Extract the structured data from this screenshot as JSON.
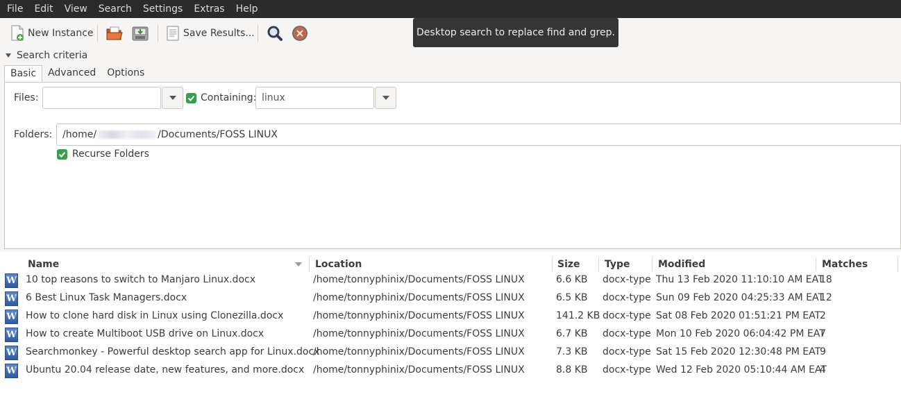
{
  "menu": [
    "File",
    "Edit",
    "View",
    "Search",
    "Settings",
    "Extras",
    "Help"
  ],
  "toolbar": {
    "new_instance": "New Instance",
    "save_results": "Save Results..."
  },
  "tooltip": "Desktop search to replace find and grep.",
  "search_criteria": {
    "expander_label": "Search criteria",
    "tabs": [
      "Basic",
      "Advanced",
      "Options"
    ],
    "files_label": "Files:",
    "files_value": "",
    "containing_label": "Containing:",
    "containing_value": "linux",
    "folders_label": "Folders:",
    "folders_value_prefix": "/home/",
    "folders_value_suffix": "/Documents/FOSS LINUX",
    "recurse_label": "Recurse Folders"
  },
  "results": {
    "columns": [
      "Name",
      "Location",
      "Size",
      "Type",
      "Modified",
      "Matches"
    ],
    "rows": [
      {
        "name": "10 top reasons to switch to Manjaro Linux.docx",
        "location": "/home/tonnyphinix/Documents/FOSS LINUX",
        "size": "6.6 KB",
        "type": "docx-type",
        "modified": "Thu 13 Feb 2020 11:10:10 AM EAT",
        "matches": "18"
      },
      {
        "name": "6 Best Linux Task Managers.docx",
        "location": "/home/tonnyphinix/Documents/FOSS LINUX",
        "size": "6.5 KB",
        "type": "docx-type",
        "modified": "Sun 09 Feb 2020 04:25:33 AM EAT",
        "matches": "12"
      },
      {
        "name": "How to clone hard disk in Linux using Clonezilla.docx",
        "location": "/home/tonnyphinix/Documents/FOSS LINUX",
        "size": "141.2 KB",
        "type": "docx-type",
        "modified": "Sat 08 Feb 2020 01:51:21 PM EAT",
        "matches": "2"
      },
      {
        "name": "How to create Multiboot USB drive on Linux.docx",
        "location": "/home/tonnyphinix/Documents/FOSS LINUX",
        "size": "6.7 KB",
        "type": "docx-type",
        "modified": "Mon 10 Feb 2020 06:04:42 PM EAT",
        "matches": "7"
      },
      {
        "name": "Searchmonkey - Powerful desktop search app for Linux.docx",
        "location": "/home/tonnyphinix/Documents/FOSS LINUX",
        "size": "7.3 KB",
        "type": "docx-type",
        "modified": "Sat 15 Feb 2020 12:30:48 PM EAT",
        "matches": "9"
      },
      {
        "name": "Ubuntu 20.04 release date, new features, and more.docx",
        "location": "/home/tonnyphinix/Documents/FOSS LINUX",
        "size": "8.8 KB",
        "type": "docx-type",
        "modified": "Wed 12 Feb 2020 05:10:44 AM EAT",
        "matches": "4"
      }
    ]
  },
  "icons": {
    "new_instance": "new-document-icon",
    "open": "open-folder-icon",
    "save": "save-disk-icon",
    "save_results": "text-file-icon",
    "search": "magnifier-icon",
    "stop": "stop-icon",
    "file_type": "word-document-icon"
  }
}
